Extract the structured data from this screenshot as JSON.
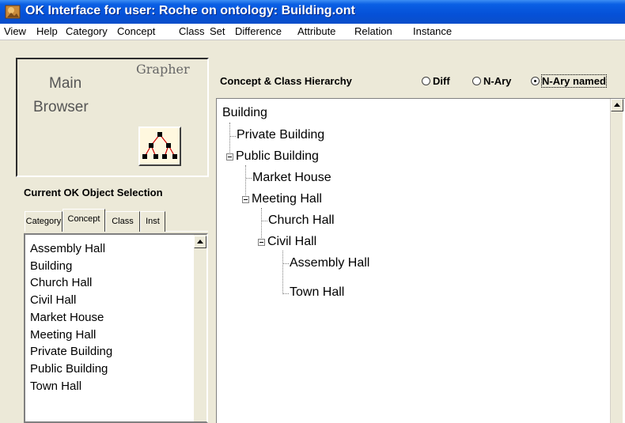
{
  "window": {
    "title": "OK Interface for user: Roche on ontology: Building.ont"
  },
  "menu": [
    "View",
    "Help",
    "Category",
    "Concept",
    "Class",
    "Set",
    "Difference",
    "Attribute",
    "Relation",
    "Instance"
  ],
  "left_panel": {
    "main_browser_line1": "Main",
    "main_browser_line2": "Browser",
    "grapher_label": "Grapher",
    "selection_heading": "Current OK Object Selection",
    "tabs": [
      "Category",
      "Concept",
      "Class",
      "Inst"
    ],
    "active_tab": "Concept",
    "list_items": [
      "Assembly Hall",
      "Building",
      "Church Hall",
      "Civil Hall",
      "Market House",
      "Meeting Hall",
      "Private Building",
      "Public Building",
      "Town Hall"
    ]
  },
  "right_panel": {
    "heading": "Concept & Class Hierarchy",
    "radios": [
      {
        "label": "Diff",
        "checked": false
      },
      {
        "label": "N-Ary",
        "checked": false
      },
      {
        "label": "N-Ary named",
        "checked": true
      }
    ],
    "tree": [
      {
        "label": "Building",
        "depth": 0
      },
      {
        "label": "Private Building",
        "depth": 1
      },
      {
        "label": "Public Building",
        "depth": 1,
        "expanded": true
      },
      {
        "label": "Market House",
        "depth": 2
      },
      {
        "label": "Meeting Hall",
        "depth": 2,
        "expanded": true
      },
      {
        "label": "Church Hall",
        "depth": 3
      },
      {
        "label": "Civil Hall",
        "depth": 3,
        "expanded": true
      },
      {
        "label": "Assembly Hall",
        "depth": 4
      },
      {
        "label": "Town Hall",
        "depth": 4
      }
    ]
  },
  "colors": {
    "titlebar": "#0551d8",
    "grapher_lines": "#cc0000"
  }
}
